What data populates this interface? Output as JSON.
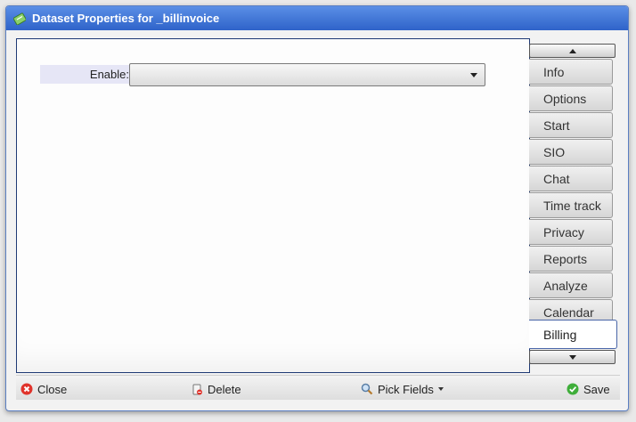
{
  "window": {
    "title": "Dataset Properties for _billinvoice"
  },
  "form": {
    "enable_label": "Enable:",
    "enable_value": ""
  },
  "tabs": [
    {
      "label": "Info",
      "active": false
    },
    {
      "label": "Options",
      "active": false
    },
    {
      "label": "Start",
      "active": false
    },
    {
      "label": "SIO",
      "active": false
    },
    {
      "label": "Chat",
      "active": false
    },
    {
      "label": "Time track",
      "active": false
    },
    {
      "label": "Privacy",
      "active": false
    },
    {
      "label": "Reports",
      "active": false
    },
    {
      "label": "Analyze",
      "active": false
    },
    {
      "label": "Calendar",
      "active": false
    },
    {
      "label": "Billing",
      "active": true
    }
  ],
  "toolbar": {
    "close_label": "Close",
    "delete_label": "Delete",
    "pick_fields_label": "Pick Fields",
    "save_label": "Save"
  },
  "icons": {
    "title": "dataset-icon",
    "close": "close-red-icon",
    "delete": "trash-icon",
    "pick_fields": "magnifier-icon",
    "save": "check-green-icon"
  },
  "colors": {
    "titlebar": "#2f63c9",
    "accent_border": "#1f3a75",
    "label_bg": "#e6e6f6"
  }
}
